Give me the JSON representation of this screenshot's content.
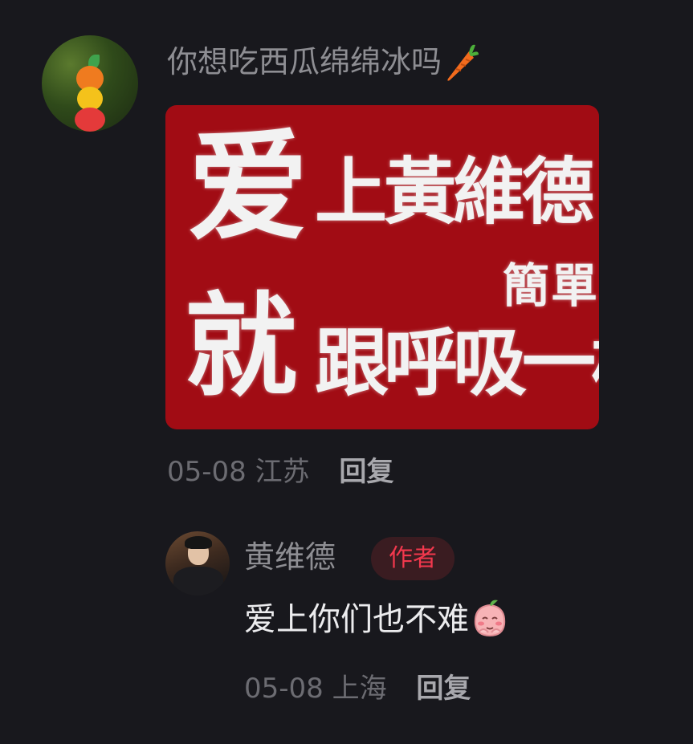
{
  "comment": {
    "username": "你想吃西瓜绵绵冰吗",
    "username_emoji": "carrot-emoji",
    "sticker": {
      "line1_big": "爱",
      "line1_rest": "上黃維德",
      "line2_small": "簡單",
      "line2_big": "就",
      "line2_rest": "跟呼吸一樣",
      "background_color": "#a10c14"
    },
    "date": "05-08",
    "location": "江苏",
    "reply_label": "回复"
  },
  "reply": {
    "username": "黄维德",
    "badge": "作者",
    "badge_color": "#f2384d",
    "text": "爱上你们也不难",
    "text_emoji": "peach-blush-emoji",
    "date": "05-08",
    "location": "上海",
    "reply_label": "回复"
  }
}
